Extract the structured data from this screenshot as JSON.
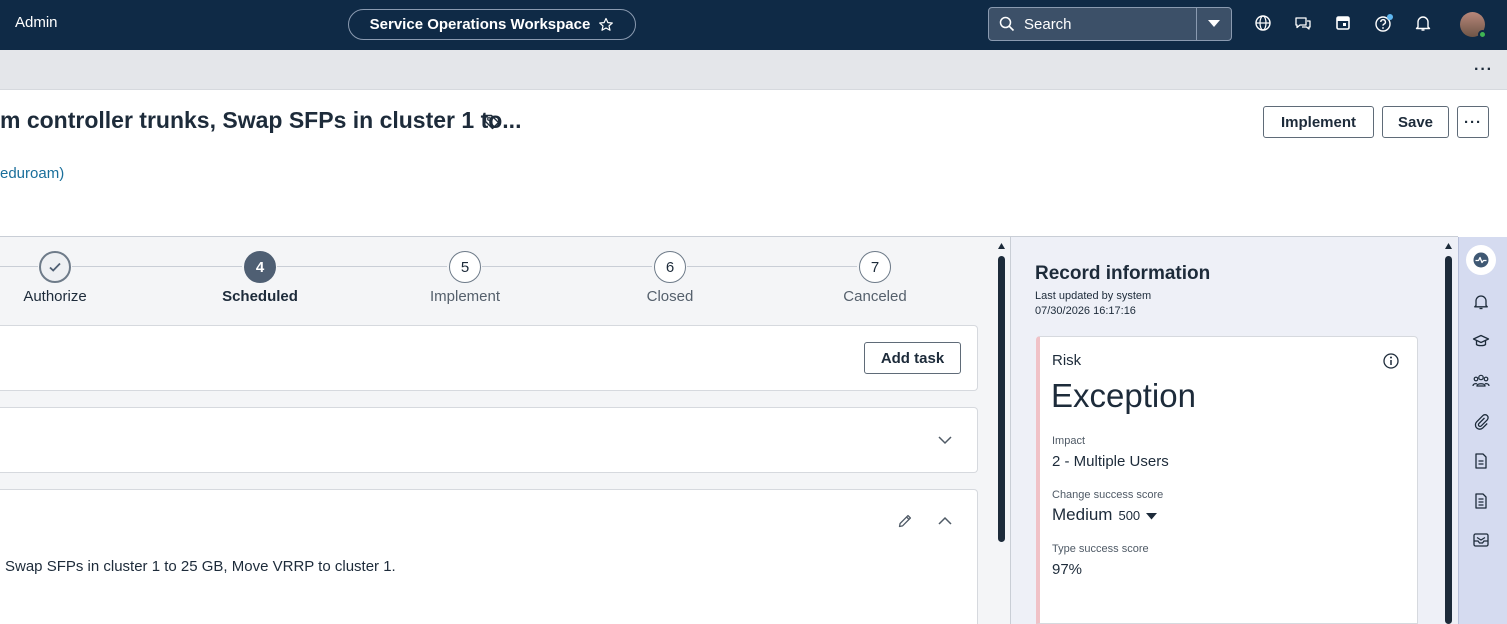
{
  "topbar": {
    "user_label": "Admin",
    "workspace_title": "Service Operations Workspace",
    "search_placeholder": "Search",
    "icons": [
      "star-icon",
      "search-icon",
      "chevron-down-icon",
      "globe-icon",
      "chat-icon",
      "calendar-icon",
      "help-icon",
      "bell-icon",
      "avatar"
    ]
  },
  "subbar": {
    "more_label": "···"
  },
  "record": {
    "title": "m controller trunks, Swap SFPs in cluster 1 to...",
    "subtitle": "eduroam)",
    "buttons": {
      "implement": "Implement",
      "save": "Save",
      "more": "···"
    }
  },
  "stepper": {
    "steps": [
      {
        "number": "",
        "label": "Authorize",
        "state": "done"
      },
      {
        "number": "4",
        "label": "Scheduled",
        "state": "active"
      },
      {
        "number": "5",
        "label": "Implement",
        "state": "pending"
      },
      {
        "number": "6",
        "label": "Closed",
        "state": "pending"
      },
      {
        "number": "7",
        "label": "Canceled",
        "state": "pending"
      }
    ]
  },
  "tasks_card": {
    "add_task_label": "Add task"
  },
  "description_card": {
    "text": "Swap SFPs in cluster 1 to 25 GB, Move VRRP to cluster 1."
  },
  "record_info": {
    "title": "Record information",
    "updated_by": "Last updated by system",
    "updated_at": "07/30/2026 16:17:16",
    "risk": {
      "label": "Risk",
      "value": "Exception",
      "impact_label": "Impact",
      "impact_value": "2 - Multiple Users",
      "change_score_label": "Change success score",
      "change_score_value": "Medium",
      "change_score_number": "500",
      "type_score_label": "Type success score",
      "type_score_value": "97%"
    }
  },
  "rail_icons": [
    "activity-icon",
    "bell-icon",
    "graduation-cap-icon",
    "group-icon",
    "paperclip-icon",
    "document-icon",
    "document-lines-icon",
    "inbox-icon"
  ],
  "colors": {
    "topbar": "#0f2a46",
    "active_step": "#4f5f73",
    "link": "#1a6f9b",
    "risk_accent": "#f0c2c7",
    "rail": "#d5dbf0"
  }
}
